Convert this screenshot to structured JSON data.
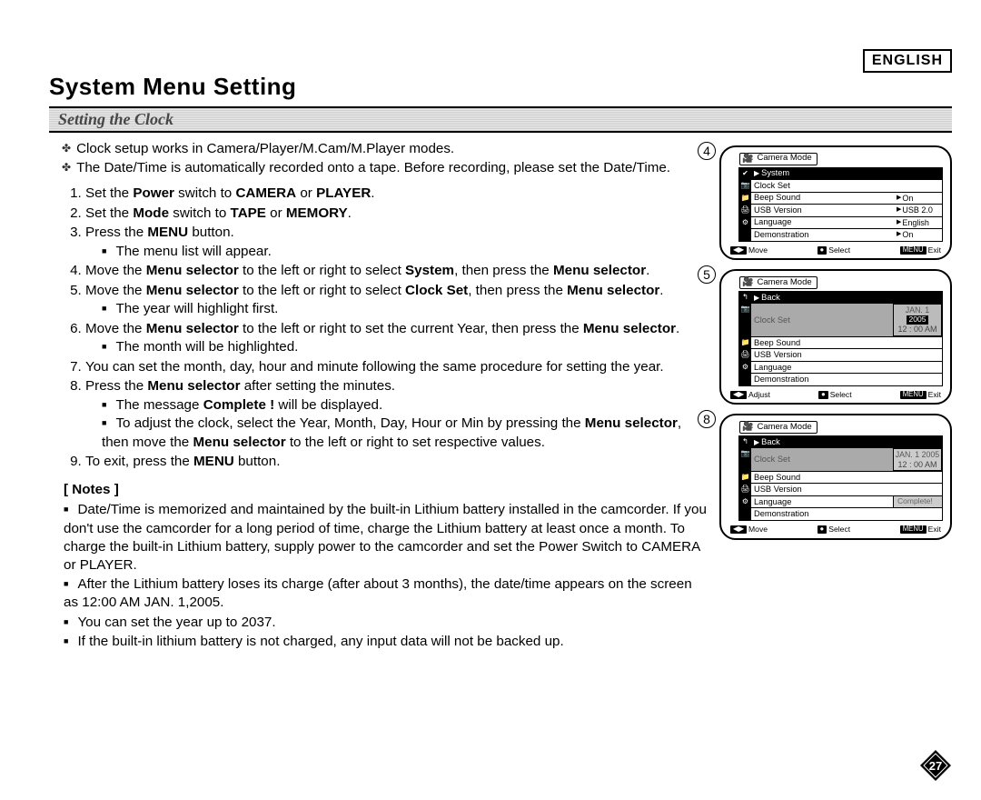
{
  "lang_label": "ENGLISH",
  "title": "System Menu Setting",
  "subhead": "Setting the Clock",
  "intro": [
    "Clock setup works in Camera/Player/M.Cam/M.Player modes.",
    "The Date/Time is automatically recorded onto a tape. Before recording, please set the Date/Time."
  ],
  "steps": {
    "s1a": "Set the ",
    "s1b": "Power",
    "s1c": " switch to ",
    "s1d": "CAMERA",
    "s1e": " or ",
    "s1f": "PLAYER",
    "s1g": ".",
    "s2a": "Set the ",
    "s2b": "Mode",
    "s2c": " switch to ",
    "s2d": "TAPE",
    "s2e": " or ",
    "s2f": "MEMORY",
    "s2g": ".",
    "s3a": "Press the ",
    "s3b": "MENU",
    "s3c": " button.",
    "s3sub": "The menu list will appear.",
    "s4a": "Move the ",
    "s4b": "Menu selector",
    "s4c": " to the left or right to select ",
    "s4d": "System",
    "s4e": ", then press the ",
    "s4f": "Menu selector",
    "s4g": ".",
    "s5a": "Move the ",
    "s5b": "Menu selector",
    "s5c": " to the left or right to select ",
    "s5d": "Clock Set",
    "s5e": ", then press the ",
    "s5f": "Menu selector",
    "s5g": ".",
    "s5sub": "The year will highlight first.",
    "s6a": "Move the ",
    "s6b": "Menu selector",
    "s6c": " to the left or right to set the current Year, then press the ",
    "s6d": "Menu selector",
    "s6e": ".",
    "s6sub": "The month will be highlighted.",
    "s7": "You can set the month, day, hour and minute following the same procedure for setting the year.",
    "s8a": "Press the ",
    "s8b": "Menu selector",
    "s8c": " after setting the minutes.",
    "s8sub1a": "The message ",
    "s8sub1b": "Complete !",
    "s8sub1c": " will be displayed.",
    "s8sub2a": "To adjust the clock, select the Year, Month, Day, Hour or Min by pressing the ",
    "s8sub2b": "Menu selector",
    "s8sub2c": ", then move the ",
    "s8sub2d": "Menu selector",
    "s8sub2e": " to the left or right to set respective values.",
    "s9a": "To exit, press the ",
    "s9b": "MENU",
    "s9c": " button."
  },
  "notes_heading": "[ Notes ]",
  "notes": [
    "Date/Time is memorized and maintained by the built-in Lithium battery installed in the camcorder. If you don't use the camcorder for a long period of time, charge the Lithium battery at least once a month. To charge the built-in Lithium battery, supply power to the camcorder and set the Power Switch to CAMERA or PLAYER.",
    "After the Lithium battery loses its charge (after about 3 months), the date/time appears on the screen as 12:00 AM JAN. 1,2005.",
    "You can set the year up to 2037.",
    "If the built-in lithium battery is not charged, any input data will not be backed up."
  ],
  "shots": {
    "mode_header": "Camera Mode",
    "items_common": {
      "system": "System",
      "back": "Back",
      "clock_set": "Clock Set",
      "beep": "Beep Sound",
      "usb": "USB Version",
      "lang": "Language",
      "demo": "Demonstration"
    },
    "vals4": {
      "beep": "On",
      "usb": "USB 2.0",
      "lang": "English",
      "demo": "On"
    },
    "vals5": {
      "date": "JAN. 1",
      "year": "2005",
      "time": "12 : 00  AM"
    },
    "vals8": {
      "date": "JAN. 1 2005",
      "time": "12 : 00 AM",
      "complete": "Complete!"
    },
    "controls": {
      "move": "Move",
      "adjust": "Adjust",
      "select": "Select",
      "exit": "Exit",
      "menu": "MENU"
    },
    "circ4": "4",
    "circ5": "5",
    "circ8": "8"
  },
  "page_number": "27"
}
